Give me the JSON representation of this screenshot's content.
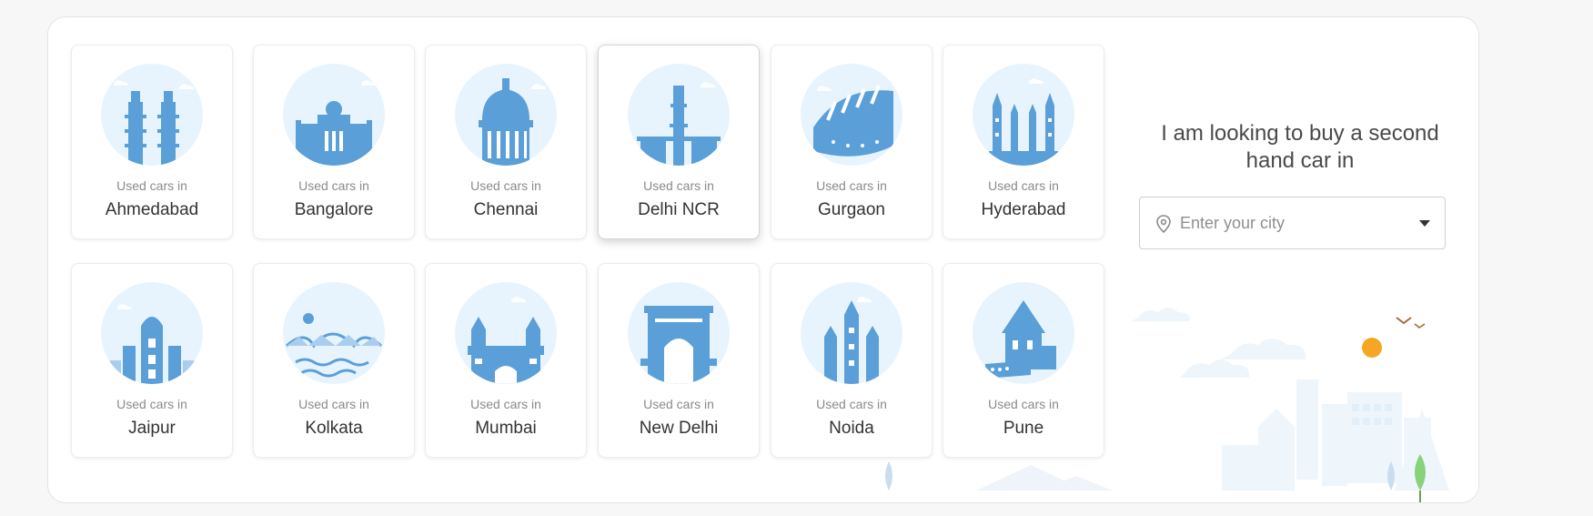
{
  "cities": [
    {
      "prefix": "Used cars in",
      "name": "Ahmedabad"
    },
    {
      "prefix": "Used cars in",
      "name": "Bangalore"
    },
    {
      "prefix": "Used cars in",
      "name": "Chennai"
    },
    {
      "prefix": "Used cars in",
      "name": "Delhi NCR"
    },
    {
      "prefix": "Used cars in",
      "name": "Gurgaon"
    },
    {
      "prefix": "Used cars in",
      "name": "Hyderabad"
    },
    {
      "prefix": "Used cars in",
      "name": "Jaipur"
    },
    {
      "prefix": "Used cars in",
      "name": "Kolkata"
    },
    {
      "prefix": "Used cars in",
      "name": "Mumbai"
    },
    {
      "prefix": "Used cars in",
      "name": "New Delhi"
    },
    {
      "prefix": "Used cars in",
      "name": "Noida"
    },
    {
      "prefix": "Used cars in",
      "name": "Pune"
    }
  ],
  "side": {
    "headline": "I am looking to buy a second hand car in",
    "city_select": {
      "placeholder": "Enter your city",
      "icon": "location-pin-icon"
    }
  },
  "theme": {
    "accent_blue": "#5b9fd8",
    "light_blue": "#e8f4fd",
    "sun": "#f5a623"
  }
}
